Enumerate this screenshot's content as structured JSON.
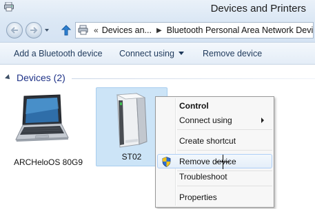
{
  "window": {
    "title": "Devices and Printers"
  },
  "address": {
    "breadcrumbs": [
      "Devices an...",
      "Bluetooth Personal Area Network Devices"
    ]
  },
  "toolbar": {
    "add_label": "Add a Bluetooth device",
    "connect_label": "Connect using",
    "remove_label": "Remove device"
  },
  "group": {
    "title": "Devices (2)"
  },
  "devices": [
    {
      "name": "ARCHeloOS 80G9"
    },
    {
      "name": "ST02",
      "selected": true
    }
  ],
  "context_menu": {
    "items": [
      {
        "label": "Control",
        "default": true
      },
      {
        "label": "Connect using",
        "submenu": true
      },
      {
        "label": "Create shortcut"
      },
      {
        "label": "Remove device",
        "icon": "shield-icon",
        "highlighted": true
      },
      {
        "label": "Troubleshoot"
      },
      {
        "label": "Properties"
      }
    ]
  },
  "colors": {
    "title_bar": "#dce8f5",
    "group_header": "#1e3287",
    "selection": "#cce4f7",
    "menu_highlight_border": "#aecff7"
  }
}
